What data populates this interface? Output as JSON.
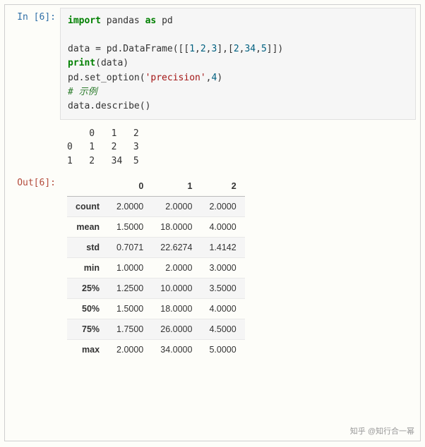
{
  "cell": {
    "in_prompt": "In [6]:",
    "out_prompt": "Out[6]:",
    "code": {
      "l1_kw1": "import",
      "l1_mod": " pandas ",
      "l1_kw2": "as",
      "l1_alias": " pd",
      "l3a": "data = pd.DataFrame([[",
      "l3n1": "1",
      "l3c1": ",",
      "l3n2": "2",
      "l3c2": ",",
      "l3n3": "3",
      "l3c3": "],[",
      "l3n4": "2",
      "l3c4": ",",
      "l3n5": "34",
      "l3c5": ",",
      "l3n6": "5",
      "l3c6": "]])",
      "l4a": "print",
      "l4b": "(data)",
      "l5a": "pd.set_option(",
      "l5s": "'precision'",
      "l5c": ",",
      "l5n": "4",
      "l5b": ")",
      "l6": "# 示例",
      "l7": "data.describe()"
    }
  },
  "print_output": {
    "header": "    0   1   2",
    "row0": "0   1   2   3",
    "row1": "1   2   34  5"
  },
  "chart_data": {
    "type": "table",
    "columns": [
      "0",
      "1",
      "2"
    ],
    "index": [
      "count",
      "mean",
      "std",
      "min",
      "25%",
      "50%",
      "75%",
      "max"
    ],
    "values": [
      [
        "2.0000",
        "2.0000",
        "2.0000"
      ],
      [
        "1.5000",
        "18.0000",
        "4.0000"
      ],
      [
        "0.7071",
        "22.6274",
        "1.4142"
      ],
      [
        "1.0000",
        "2.0000",
        "3.0000"
      ],
      [
        "1.2500",
        "10.0000",
        "3.5000"
      ],
      [
        "1.5000",
        "18.0000",
        "4.0000"
      ],
      [
        "1.7500",
        "26.0000",
        "4.5000"
      ],
      [
        "2.0000",
        "34.0000",
        "5.0000"
      ]
    ]
  },
  "watermark": "知乎 @知行合一幂"
}
